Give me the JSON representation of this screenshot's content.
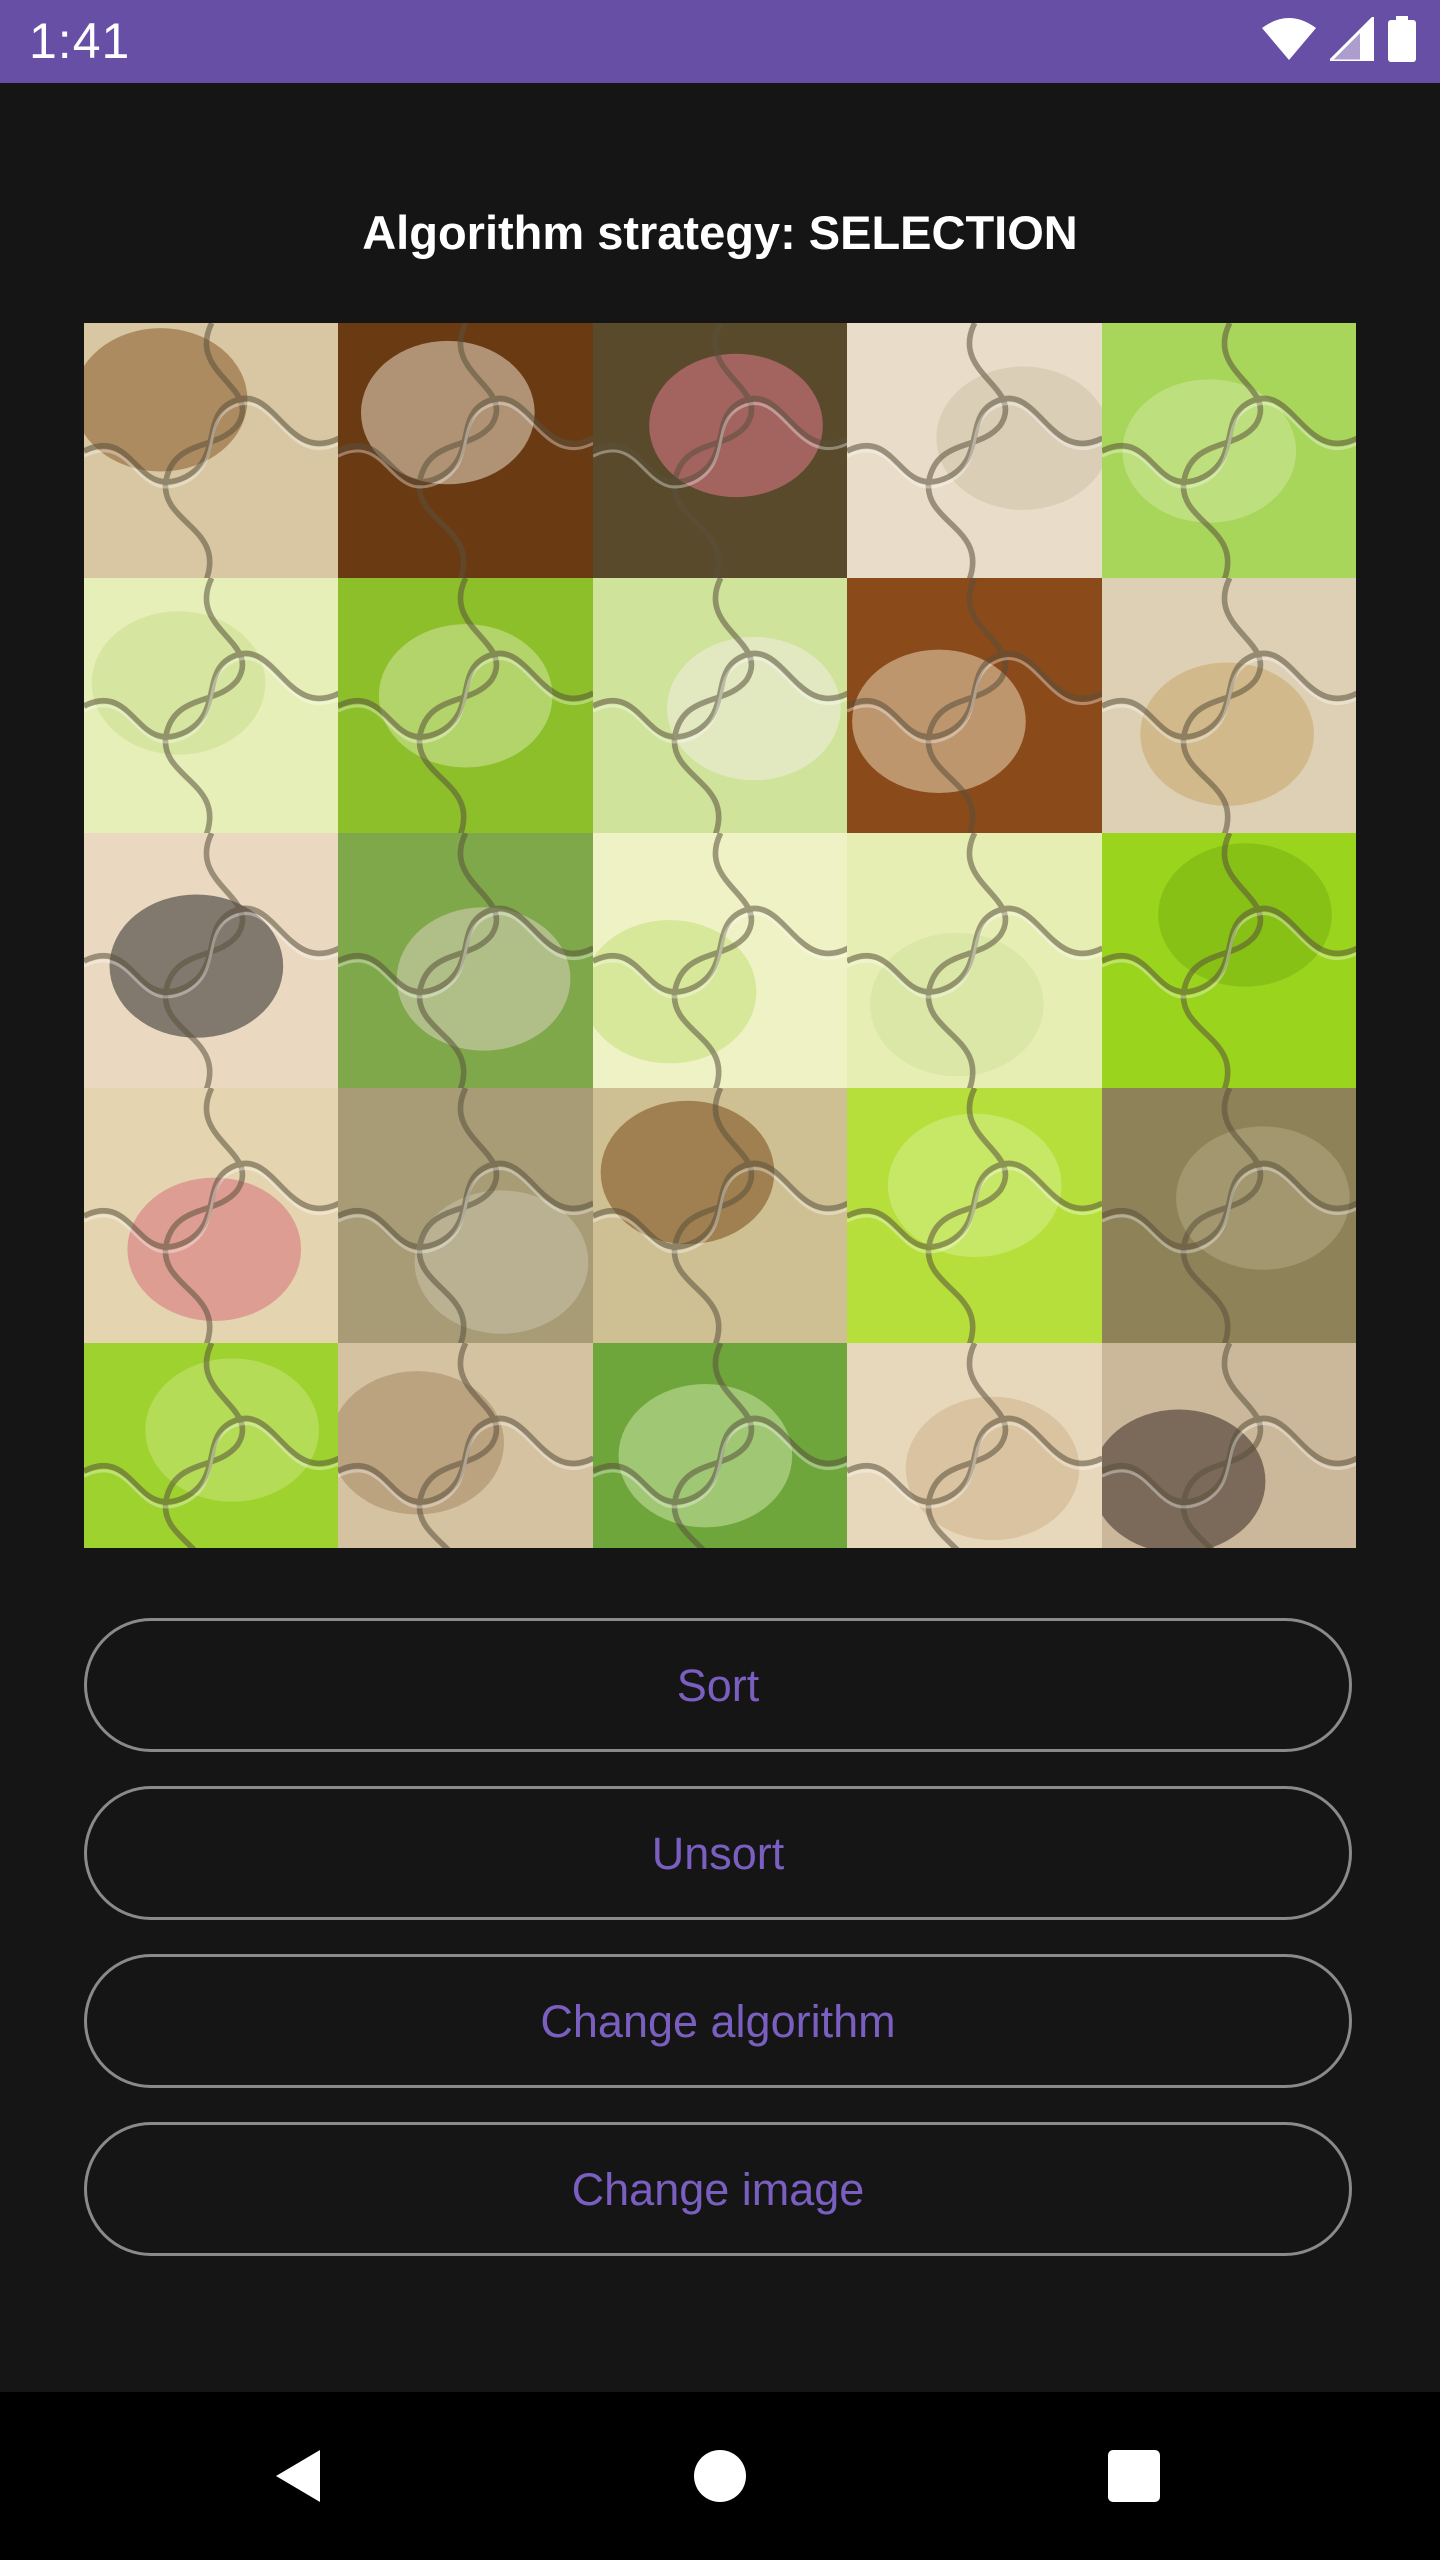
{
  "status_bar": {
    "time": "1:41",
    "icons": [
      "wifi-icon",
      "signal-icon",
      "battery-icon"
    ]
  },
  "main": {
    "title": "Algorithm strategy: SELECTION"
  },
  "puzzle": {
    "columns": 5,
    "rows": 5
  },
  "buttons": {
    "sort": "Sort",
    "unsort": "Unsort",
    "change_algorithm": "Change algorithm",
    "change_image": "Change image"
  },
  "nav_bar": {
    "icons": [
      "back-icon",
      "home-icon",
      "recents-icon"
    ]
  },
  "colors": {
    "status_bar": "#674fa5",
    "background": "#151515",
    "accent": "#7a5fc0",
    "button_outline": "#8a8a8a"
  }
}
